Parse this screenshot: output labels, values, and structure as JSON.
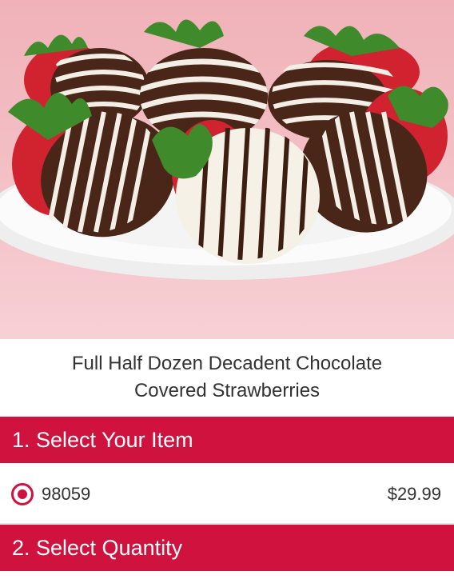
{
  "product": {
    "image_alt": "Chocolate covered strawberries on a white plate",
    "title_line1": "Full Half Dozen Decadent Chocolate",
    "title_line2": "Covered Strawberries"
  },
  "sections": {
    "select_item": "1. Select Your Item",
    "select_quantity": "2. Select Quantity"
  },
  "option": {
    "code": "98059",
    "price": "$29.99",
    "selected": true
  },
  "colors": {
    "accent": "#d0123f",
    "background": "#ffffff",
    "text": "#333333"
  }
}
